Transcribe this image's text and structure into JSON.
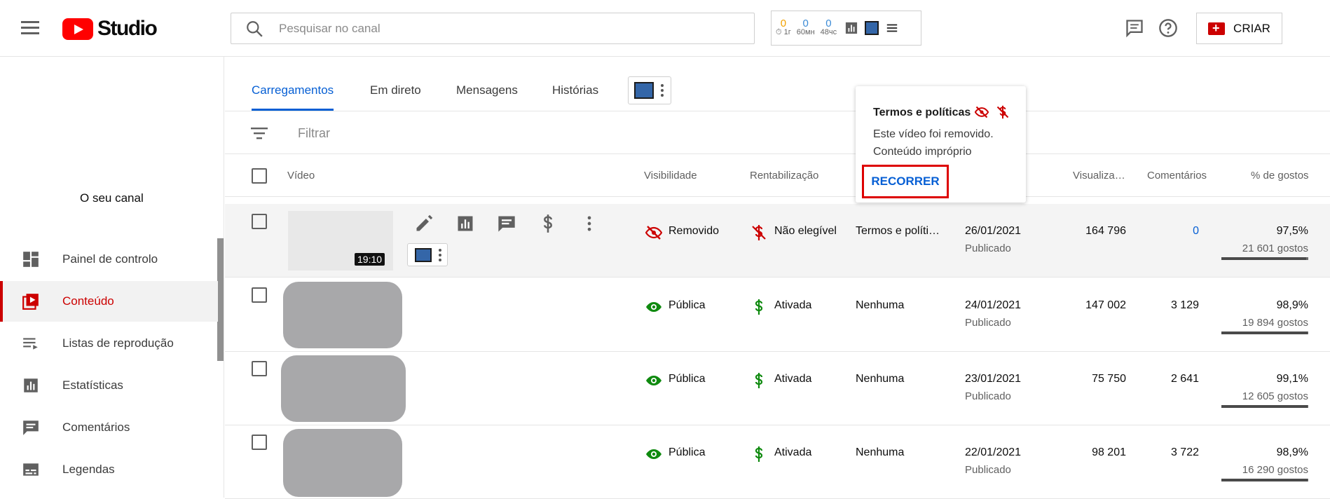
{
  "app": {
    "logo_text": "Studio",
    "brand_color": "#ff0000",
    "accent": "#065fd4"
  },
  "search": {
    "placeholder": "Pesquisar no canal"
  },
  "widget": {
    "stats": [
      {
        "value": "0",
        "label": "⏱ 1г"
      },
      {
        "value": "0",
        "label": "60мн"
      },
      {
        "value": "0",
        "label": "48чс"
      }
    ]
  },
  "header_actions": {
    "create_label": "CRIAR"
  },
  "sidebar": {
    "channel_label": "O seu canal",
    "items": [
      {
        "label": "Painel de controlo",
        "icon": "dashboard-icon"
      },
      {
        "label": "Conteúdo",
        "icon": "content-icon"
      },
      {
        "label": "Listas de reprodução",
        "icon": "playlist-icon"
      },
      {
        "label": "Estatísticas",
        "icon": "analytics-icon"
      },
      {
        "label": "Comentários",
        "icon": "comments-icon"
      },
      {
        "label": "Legendas",
        "icon": "subtitles-icon"
      }
    ]
  },
  "tabs": [
    "Carregamentos",
    "Em direto",
    "Mensagens",
    "Histórias"
  ],
  "filter": {
    "placeholder": "Filtrar"
  },
  "columns": {
    "video": "Vídeo",
    "visibility": "Visibilidade",
    "monetization": "Rentabilização",
    "views": "Visualiza…",
    "comments": "Comentários",
    "likes": "% de gostos"
  },
  "popup": {
    "title": "Termos e políticas",
    "line1": "Este vídeo foi removido.",
    "line2": "Conteúdo impróprio",
    "action": "RECORRER"
  },
  "rows": [
    {
      "duration": "19:10",
      "visibility": "Removido",
      "monetization": "Não elegível",
      "restrictions": "Termos e políti…",
      "date": "26/01/2021",
      "status": "Publicado",
      "views": "164 796",
      "comments": "0",
      "likes_pct": "97,5%",
      "likes_count": "21 601 gostos",
      "likes_ratio": 0.975
    },
    {
      "visibility": "Pública",
      "monetization": "Ativada",
      "restrictions": "Nenhuma",
      "date": "24/01/2021",
      "status": "Publicado",
      "views": "147 002",
      "comments": "3 129",
      "likes_pct": "98,9%",
      "likes_count": "19 894 gostos",
      "likes_ratio": 0.989
    },
    {
      "visibility": "Pública",
      "monetization": "Ativada",
      "restrictions": "Nenhuma",
      "date": "23/01/2021",
      "status": "Publicado",
      "views": "75 750",
      "comments": "2 641",
      "likes_pct": "99,1%",
      "likes_count": "12 605 gostos",
      "likes_ratio": 0.991
    },
    {
      "visibility": "Pública",
      "monetization": "Ativada",
      "restrictions": "Nenhuma",
      "date": "22/01/2021",
      "status": "Publicado",
      "views": "98 201",
      "comments": "3 722",
      "likes_pct": "98,9%",
      "likes_count": "16 290 gostos",
      "likes_ratio": 0.989
    }
  ]
}
